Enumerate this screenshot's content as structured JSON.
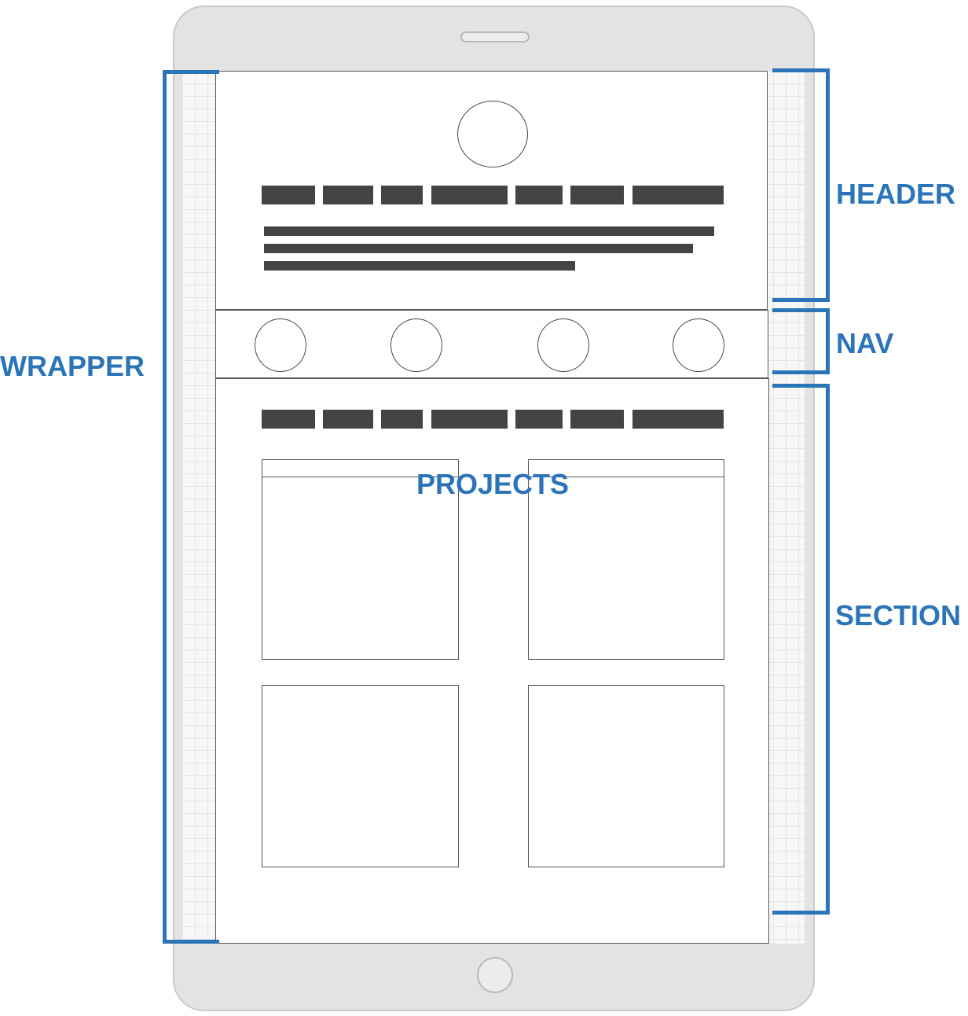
{
  "labels": {
    "wrapper": "WRAPPER",
    "header": "HEADER",
    "nav": "NAV",
    "section": "SECTION",
    "projects": "PROJECTS"
  },
  "colors": {
    "annotation": "#2b74b8",
    "placeholder_block": "#444444",
    "wireframe_border": "#555555",
    "device_body": "#e3e3e3"
  },
  "icons": {
    "header_avatar": "circle-placeholder-icon",
    "nav_items": [
      "circle-placeholder-icon",
      "circle-placeholder-icon",
      "circle-placeholder-icon",
      "circle-placeholder-icon"
    ]
  }
}
